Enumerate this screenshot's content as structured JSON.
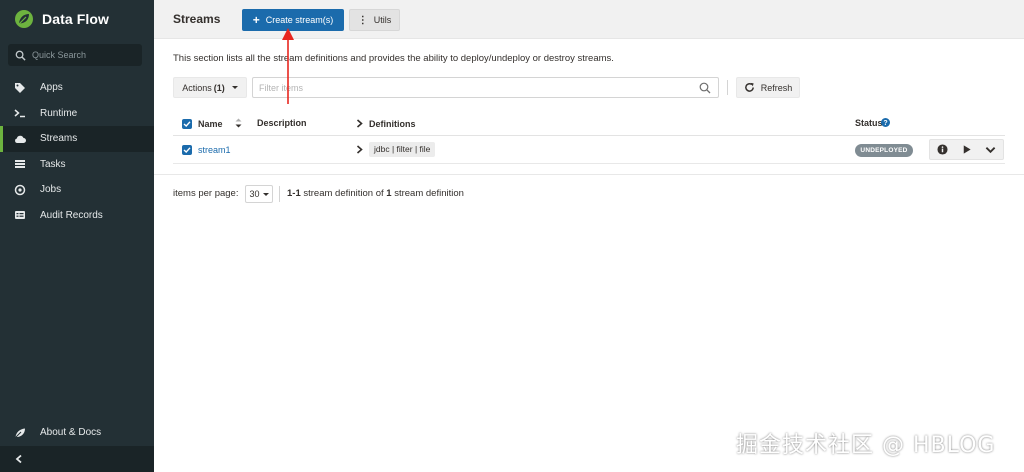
{
  "colors": {
    "sidebar_bg": "#233035",
    "sidebar_active_bg": "#1a2427",
    "brand_green": "#6db33f",
    "primary_blue": "#1b6bac",
    "annotation_red": "#e8261f",
    "badge_grey": "#808c93"
  },
  "sidebar": {
    "brand": "Data Flow",
    "brand_icon": "spring-leaf-icon",
    "quick_search_placeholder": "Quick Search",
    "items": [
      {
        "label": "Apps",
        "icon": "tags-icon",
        "active": false
      },
      {
        "label": "Runtime",
        "icon": "terminal-icon",
        "active": false
      },
      {
        "label": "Streams",
        "icon": "cloud-icon",
        "active": true
      },
      {
        "label": "Tasks",
        "icon": "tasks-icon",
        "active": false
      },
      {
        "label": "Jobs",
        "icon": "jobs-icon",
        "active": false
      },
      {
        "label": "Audit Records",
        "icon": "audit-icon",
        "active": false
      }
    ],
    "about": "About & Docs",
    "collapse_icon": "chevron-left-icon"
  },
  "header": {
    "title": "Streams",
    "create_label": "Create stream(s)",
    "utils_label": "Utils"
  },
  "main": {
    "description": "This section lists all the stream definitions and provides the ability to deploy/undeploy or destroy streams.",
    "actions_label": "Actions",
    "actions_count": "(1)",
    "filter_placeholder": "Filter items",
    "refresh_label": "Refresh"
  },
  "table": {
    "headers": {
      "name": "Name",
      "description": "Description",
      "definitions": "Definitions",
      "status": "Status"
    },
    "rows": [
      {
        "name": "stream1",
        "description": "",
        "definition": "jdbc | filter | file",
        "status": "UNDEPLOYED",
        "checked": true
      }
    ]
  },
  "pagination": {
    "label": "items per page:",
    "per_page": "30",
    "range": "1-1",
    "mid": "stream definition of",
    "total": "1",
    "suffix": "stream definition"
  },
  "watermark": "掘金技术社区 @ HBLOG"
}
